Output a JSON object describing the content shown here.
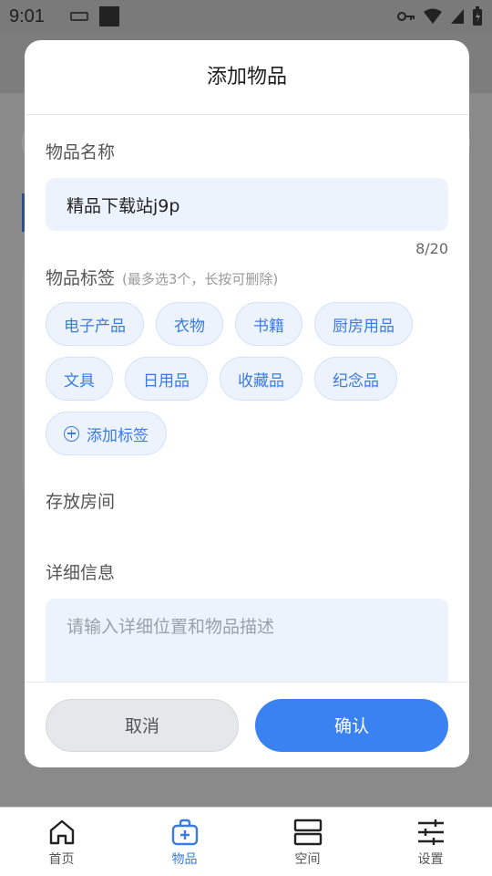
{
  "status_bar": {
    "time": "9:01"
  },
  "dialog": {
    "title": "添加物品",
    "name_label": "物品名称",
    "name_value": "精品下载站j9p",
    "name_counter": "8/20",
    "tags_label": "物品标签",
    "tags_hint": "(最多选3个，长按可删除)",
    "tags": [
      "电子产品",
      "衣物",
      "书籍",
      "厨房用品",
      "文具",
      "日用品",
      "收藏品",
      "纪念品"
    ],
    "add_tag_label": "添加标签",
    "room_label": "存放房间",
    "detail_label": "详细信息",
    "detail_placeholder": "请输入详细位置和物品描述",
    "cancel_label": "取消",
    "confirm_label": "确认"
  },
  "bottom_nav": {
    "items": [
      {
        "label": "首页",
        "icon": "home-icon"
      },
      {
        "label": "物品",
        "icon": "bag-icon"
      },
      {
        "label": "空间",
        "icon": "space-icon"
      },
      {
        "label": "设置",
        "icon": "sliders-icon"
      }
    ],
    "active": 1
  },
  "colors": {
    "accent": "#3a82f1",
    "tag_bg": "#edf3fd",
    "tag_text": "#3a7be0"
  }
}
